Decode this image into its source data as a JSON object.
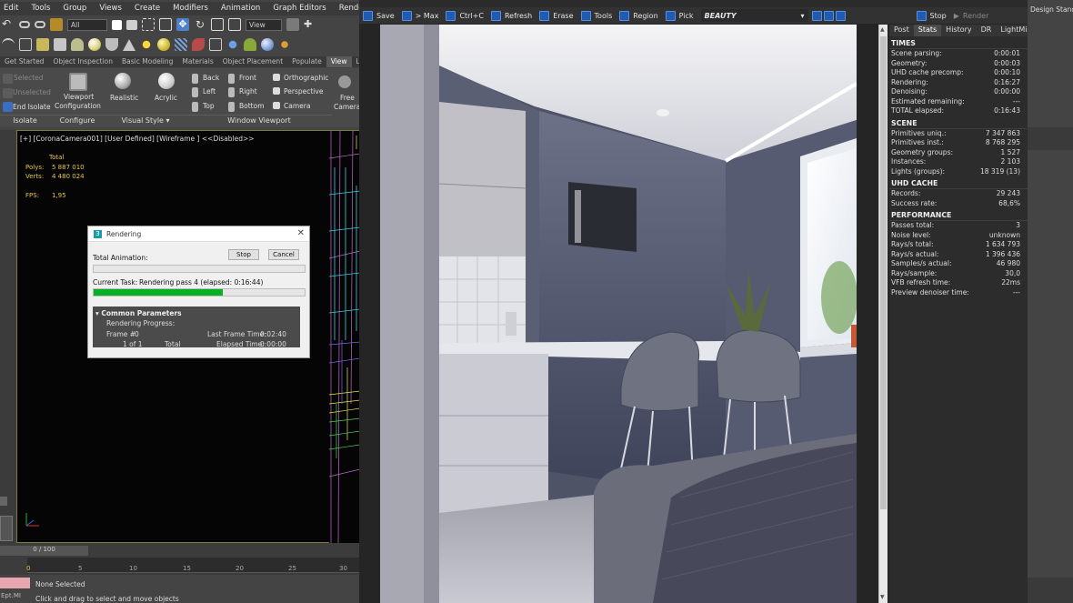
{
  "menu": [
    "Edit",
    "Tools",
    "Group",
    "Views",
    "Create",
    "Modifiers",
    "Animation",
    "Graph Editors",
    "Rendering"
  ],
  "toolbar": {
    "selection_filter": "All",
    "ref_coord": "View"
  },
  "ribbon_tabs": [
    "Get Started",
    "Object Inspection",
    "Basic Modeling",
    "Materials",
    "Object Placement",
    "Populate",
    "View",
    "Li"
  ],
  "ribbon_active_tab": "View",
  "ribbon": {
    "isolate": {
      "selected": "Selected",
      "unselected": "Unselected",
      "end_isolate": "End Isolate",
      "group": "Isolate"
    },
    "configure": {
      "viewport_config_1": "Viewport",
      "viewport_config_2": "Configuration",
      "group": "Configure"
    },
    "visual_style": {
      "realistic": "Realistic",
      "acrylic": "Acrylic",
      "group": "Visual Style ▾"
    },
    "window_viewport": {
      "back": "Back",
      "left": "Left",
      "top": "Top",
      "front": "Front",
      "right": "Right",
      "bottom": "Bottom",
      "orthographic": "Orthographic",
      "perspective": "Perspective",
      "camera": "Camera",
      "free_camera_1": "Free",
      "free_camera_2": "Camera",
      "group": "Window Viewport"
    }
  },
  "viewport": {
    "header": "[+] [CoronaCamera001] [User Defined] [Wireframe ] <<Disabled>>",
    "total_label": "Total",
    "polys_label": "Polys:",
    "polys": "5 887 010",
    "verts_label": "Verts:",
    "verts": "4 480 024",
    "fps_label": "FPS:",
    "fps": "1,95"
  },
  "render_dialog": {
    "title": "Rendering",
    "total_animation": "Total Animation:",
    "stop": "Stop",
    "cancel": "Cancel",
    "current_task_label": "Current Task:",
    "current_task": "Rendering pass 4 (elapsed: 0:16:44)",
    "progress_fraction": 0.61,
    "common_params": "Common Parameters",
    "rendering_progress": "Rendering Progress:",
    "frame_label": "Frame #",
    "frame": "0",
    "last_frame_label": "Last Frame Time:",
    "last_frame": "0:02:40",
    "of_label": "1 of 1",
    "total_label": "Total",
    "elapsed_label": "Elapsed Time:",
    "elapsed": "0:00:00"
  },
  "timeline": {
    "slider": "0 / 100",
    "ticks": [
      "5",
      "10",
      "15",
      "20",
      "25",
      "30"
    ],
    "frame_start": "0"
  },
  "status": {
    "none_selected": "None Selected",
    "hint": "Click and drag to select and move objects",
    "script": "Ept.MI"
  },
  "vfb_toolbar": [
    {
      "icon": "save-icon",
      "label": "Save"
    },
    {
      "icon": "max-icon",
      "label": "> Max"
    },
    {
      "icon": "copy-icon",
      "label": "Ctrl+C"
    },
    {
      "icon": "refresh-icon",
      "label": "Refresh"
    },
    {
      "icon": "erase-icon",
      "label": "Erase"
    },
    {
      "icon": "tools-icon",
      "label": "Tools"
    },
    {
      "icon": "region-icon",
      "label": "Region"
    },
    {
      "icon": "pick-icon",
      "label": "Pick"
    }
  ],
  "vfb_channel": "BEAUTY",
  "vfb_stop": "Stop",
  "vfb_render": "Render",
  "stats_tabs": [
    "Post",
    "Stats",
    "History",
    "DR",
    "LightMix"
  ],
  "stats_active": "Stats",
  "stats": [
    {
      "section": "TIMES",
      "rows": [
        [
          "Scene parsing:",
          "0:00:01"
        ],
        [
          "Geometry:",
          "0:00:03"
        ],
        [
          "UHD cache precomp:",
          "0:00:10"
        ],
        [
          "Rendering:",
          "0:16:27"
        ],
        [
          "Denoising:",
          "0:00:00"
        ],
        [
          "Estimated remaining:",
          "---"
        ],
        [
          "TOTAL elapsed:",
          "0:16:43"
        ]
      ]
    },
    {
      "section": "SCENE",
      "rows": [
        [
          "Primitives uniq.:",
          "7 347 863"
        ],
        [
          "Primitives inst.:",
          "8 768 295"
        ],
        [
          "Geometry groups:",
          "1 527"
        ],
        [
          "Instances:",
          "2 103"
        ],
        [
          "Lights (groups):",
          "18 319 (13)"
        ]
      ]
    },
    {
      "section": "UHD CACHE",
      "rows": [
        [
          "Records:",
          "29 243"
        ],
        [
          "Success rate:",
          "68,6%"
        ]
      ]
    },
    {
      "section": "PERFORMANCE",
      "rows": [
        [
          "Passes total:",
          "3"
        ],
        [
          "Noise level:",
          "unknown"
        ],
        [
          "Rays/s total:",
          "1 634 793"
        ],
        [
          "Rays/s actual:",
          "1 396 436"
        ],
        [
          "Samples/s actual:",
          "46 980"
        ],
        [
          "Rays/sample:",
          "30,0"
        ],
        [
          "VFB refresh time:",
          "22ms"
        ],
        [
          "Preview denoiser time:",
          "---"
        ]
      ]
    }
  ],
  "right_panel": {
    "workspace": "Design Standa"
  }
}
